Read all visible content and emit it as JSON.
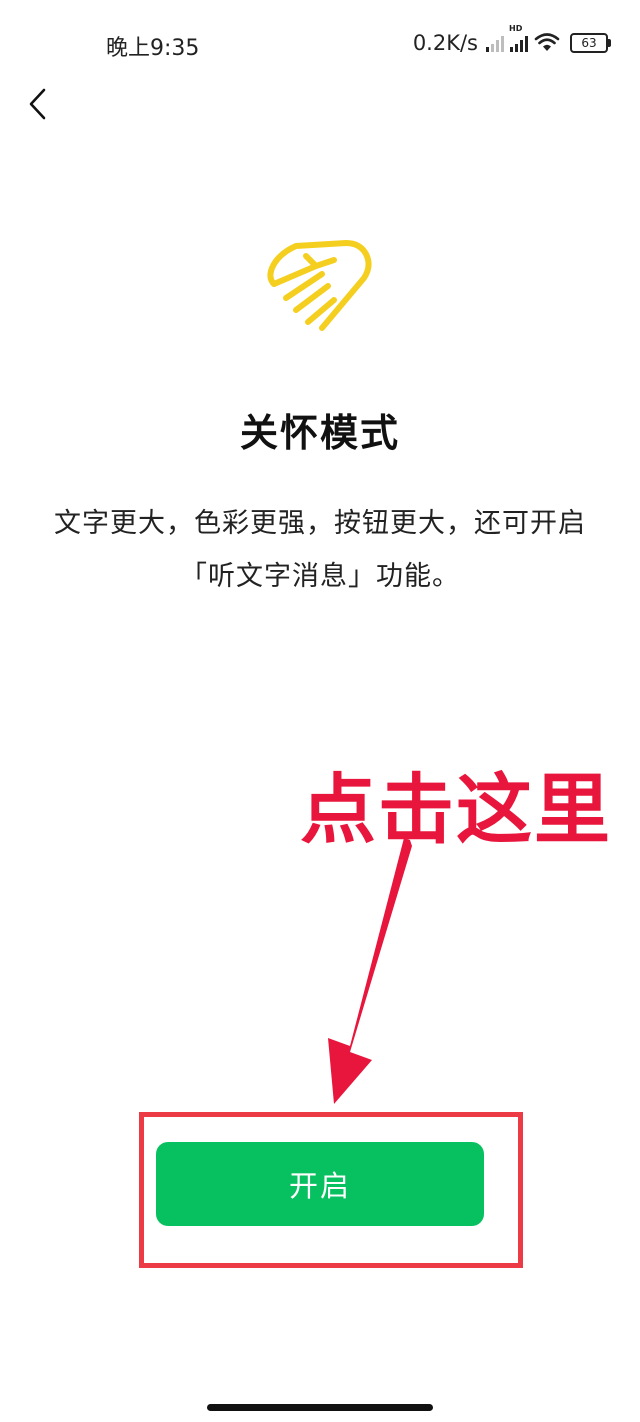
{
  "status_bar": {
    "time": "晚上9:35",
    "net_speed": "0.2K/s",
    "hd_label": "HD",
    "battery": "63"
  },
  "page": {
    "title": "关怀模式",
    "description": "文字更大，色彩更强，按钮更大，还可开启「听文字消息」功能。"
  },
  "button": {
    "label": "开启",
    "color": "#07c160"
  },
  "annotation": {
    "text": "点击这里",
    "color": "#e8163c"
  },
  "icons": {
    "back": "chevron-left-icon",
    "logo": "care-mode-heart-hand-icon",
    "signal": "signal-icon",
    "wifi": "wifi-icon",
    "battery": "battery-icon"
  },
  "colors": {
    "logo": "#f5cf1f",
    "highlight_box": "#ec3b45"
  }
}
